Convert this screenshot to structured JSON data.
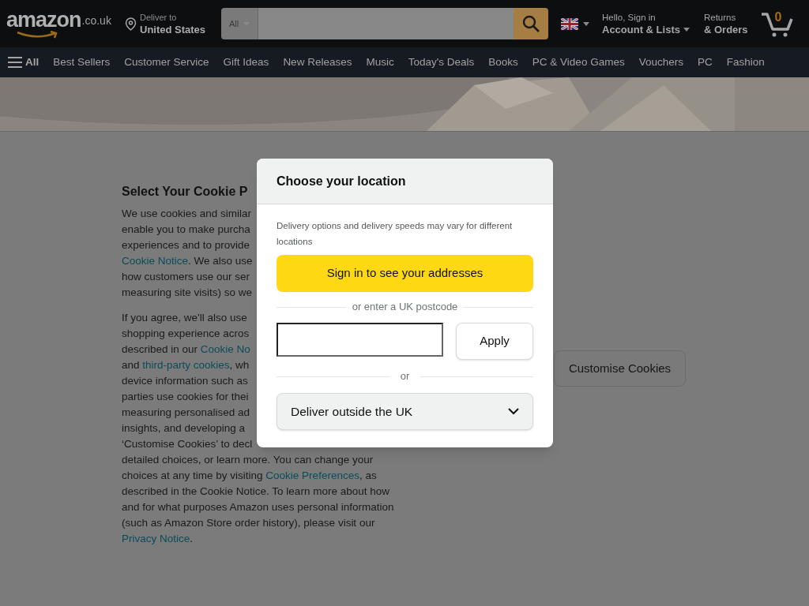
{
  "header": {
    "logo": "amazon",
    "logo_suffix": ".co.uk",
    "deliver_label": "Deliver to",
    "deliver_location": "United States",
    "search_category": "All",
    "account_greeting": "Hello, Sign in",
    "account_label": "Account & Lists",
    "returns_label": "Returns",
    "orders_label": "& Orders",
    "cart_count": "0"
  },
  "nav": {
    "menu_label": "All",
    "items": [
      "Best Sellers",
      "Customer Service",
      "Gift Ideas",
      "New Releases",
      "Music",
      "Today's Deals",
      "Books",
      "PC & Video Games",
      "Vouchers",
      "PC",
      "Fashion"
    ]
  },
  "cookie": {
    "title": "Select Your Cookie P",
    "paragraphs": [
      [
        [
          {
            "kind": "text",
            "text": "We use cookies and similar"
          }
        ],
        [
          {
            "kind": "text",
            "text": "enable you to make purcha"
          }
        ],
        [
          {
            "kind": "text",
            "text": "experiences and to provide"
          }
        ],
        [
          {
            "kind": "link",
            "text": "Cookie Notice"
          },
          {
            "kind": "text",
            "text": ". We also use"
          }
        ],
        [
          {
            "kind": "text",
            "text": "how customers use our ser"
          }
        ],
        [
          {
            "kind": "text",
            "text": "measuring site visits) so we"
          }
        ]
      ],
      [
        [
          {
            "kind": "text",
            "text": "If you agree, we'll also use"
          }
        ],
        [
          {
            "kind": "text",
            "text": "shopping experience acros"
          }
        ],
        [
          {
            "kind": "text",
            "text": "described in our "
          },
          {
            "kind": "link",
            "text": "Cookie No"
          }
        ],
        [
          {
            "kind": "text",
            "text": "and "
          },
          {
            "kind": "link",
            "text": "third-party cookies"
          },
          {
            "kind": "text",
            "text": ", wh"
          }
        ],
        [
          {
            "kind": "text",
            "text": "device information such as"
          }
        ],
        [
          {
            "kind": "text",
            "text": "parties use cookies for thei"
          }
        ],
        [
          {
            "kind": "text",
            "text": "measuring personalised ad"
          }
        ],
        [
          {
            "kind": "text",
            "text": "insights, and developing a"
          }
        ],
        [
          {
            "kind": "text",
            "text": "‘Customise Cookies’ to decl"
          }
        ],
        [
          {
            "kind": "text",
            "text": "detailed choices, or learn more. You can change your"
          }
        ],
        [
          {
            "kind": "text",
            "text": "choices at any time by visiting "
          },
          {
            "kind": "link",
            "text": "Cookie Preferences"
          },
          {
            "kind": "text",
            "text": ", as"
          }
        ],
        [
          {
            "kind": "text",
            "text": "described in the Cookie Notice. To learn more about how"
          }
        ],
        [
          {
            "kind": "text",
            "text": "and for what purposes Amazon uses personal information"
          }
        ],
        [
          {
            "kind": "text",
            "text": "(such as Amazon Store order history), please visit our"
          }
        ],
        [
          {
            "kind": "link",
            "text": "Privacy Notice"
          },
          {
            "kind": "text",
            "text": "."
          }
        ]
      ]
    ],
    "customise_button": "Customise Cookies"
  },
  "modal": {
    "title": "Choose your location",
    "description": "Delivery options and delivery speeds may vary for different locations",
    "sign_in_button": "Sign in to see your addresses",
    "postcode_divider": "or enter a UK postcode",
    "apply_button": "Apply",
    "or_divider": "or",
    "outside_select": "Deliver outside the UK"
  }
}
